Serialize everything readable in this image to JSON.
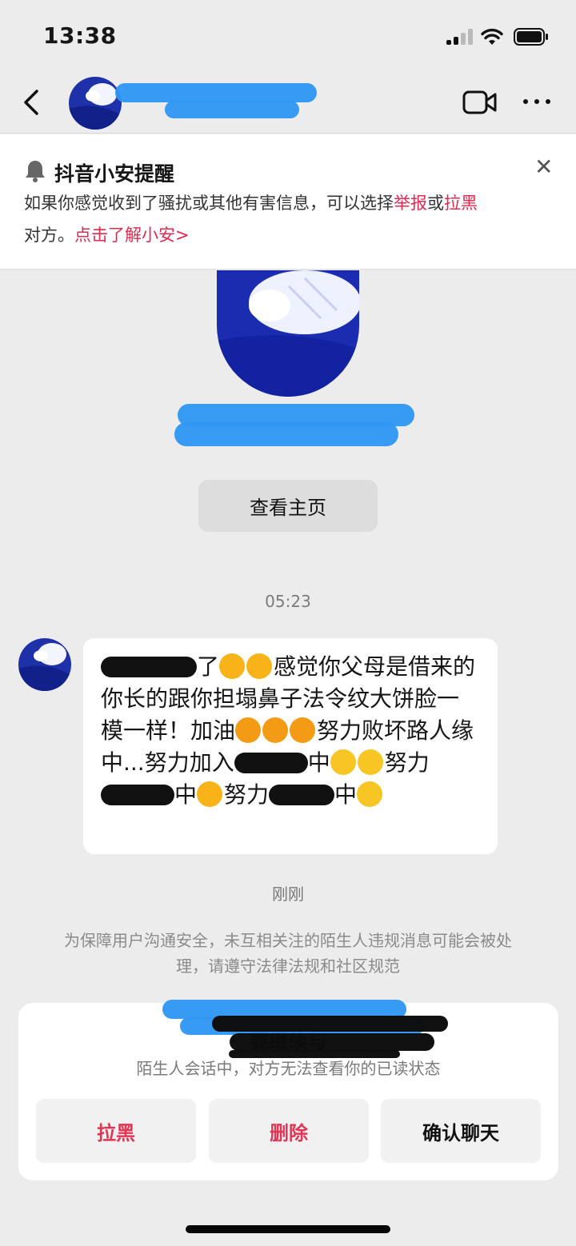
{
  "status_bar": {
    "time": "13:38"
  },
  "header": {
    "contact_name": ""
  },
  "safety_notice": {
    "title": "抖音小安提醒",
    "text_before": "如果你感觉收到了骚扰或其他有害信息，可以选择",
    "report_link": "举报",
    "or_text": "或",
    "block_link": "拉黑",
    "text_after": "对方。",
    "learn_more": "点击了解小安>"
  },
  "profile": {
    "view_homepage": "查看主页"
  },
  "chat": {
    "time": "05:23",
    "message": {
      "part1": "了",
      "part2": "感觉你父母是借来的 你长的跟你担塌鼻子法令纹大饼脸一模一样！加油",
      "part3": "努力败坏路人缘中...努力加入",
      "part4": "中",
      "part5": "努力",
      "part6": "中",
      "part7": "努力",
      "part8": "中"
    },
    "sent_time": "刚刚",
    "notice": "为保障用户沟通安全，未互相关注的陌生人违规消息可能会被处理，请遵守法律法规和社区规范"
  },
  "confirm_panel": {
    "title": "要继续与",
    "subtitle": "陌生人会话中，对方无法查看你的已读状态",
    "block_button": "拉黑",
    "delete_button": "删除",
    "confirm_button": "确认聊天"
  },
  "colors": {
    "accent_red": "#e02a4f",
    "blue_redaction": "#2f97f2",
    "background": "#ececec"
  },
  "icons": [
    "back-icon",
    "video-call-icon",
    "more-icon",
    "bell-icon",
    "close-icon",
    "signal-icon",
    "wifi-icon",
    "battery-icon"
  ]
}
